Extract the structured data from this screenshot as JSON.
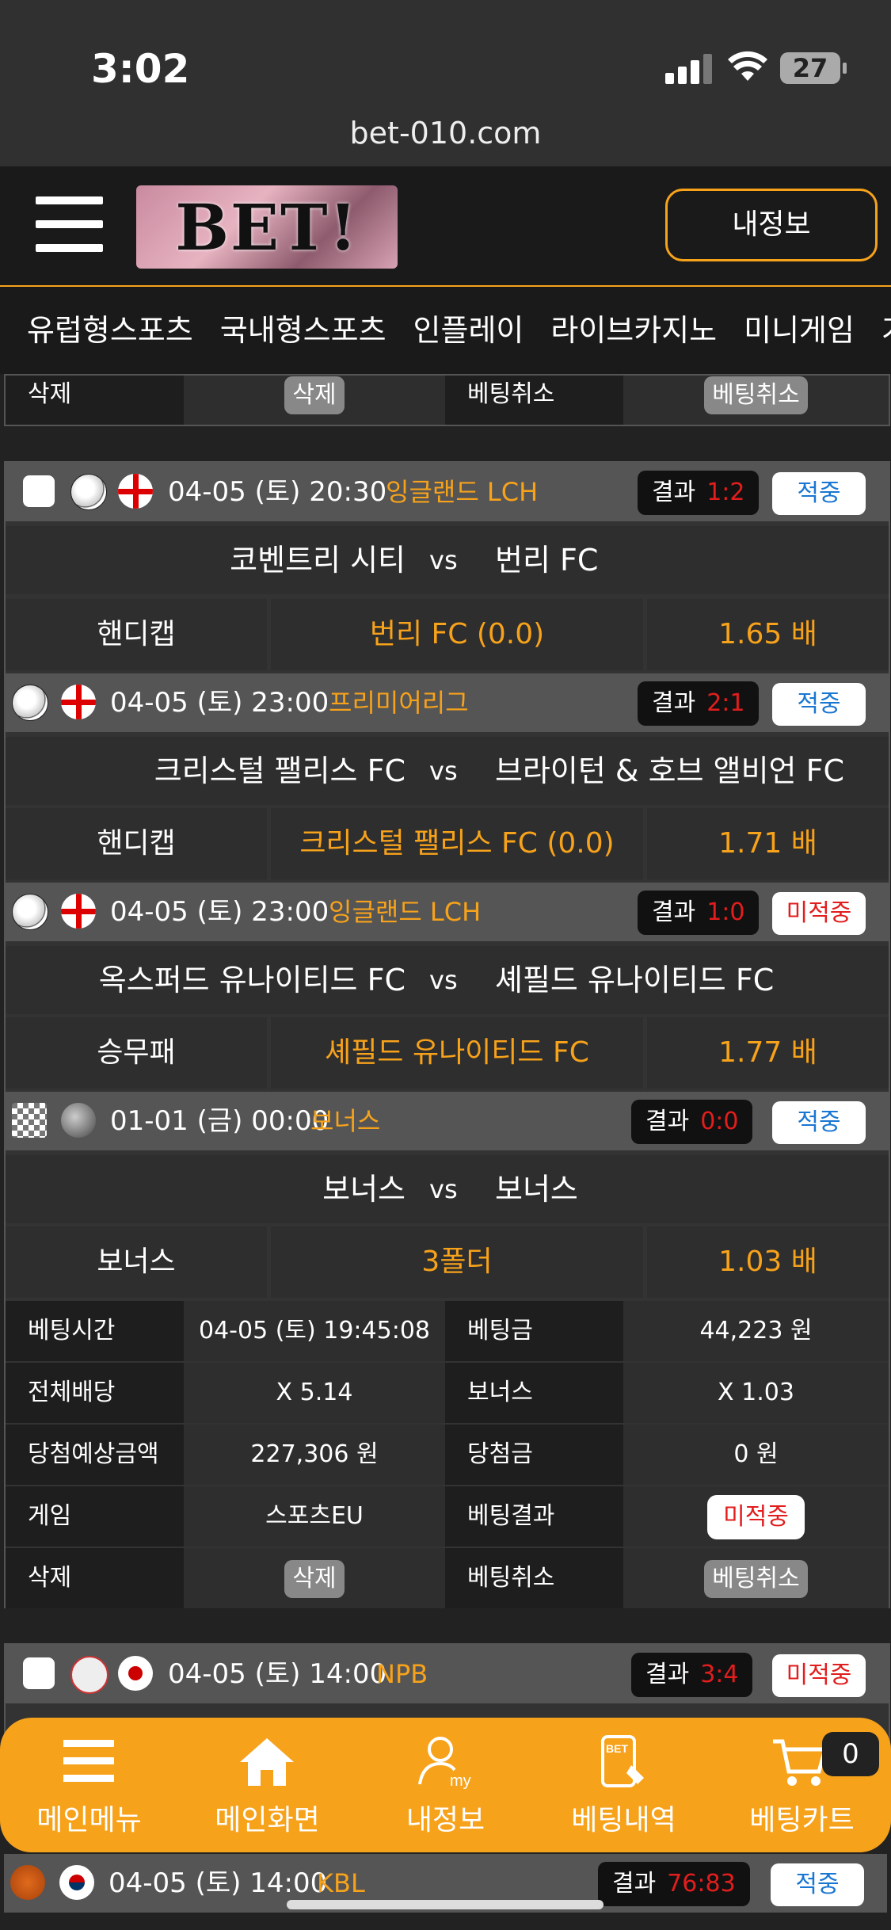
{
  "status_bar": {
    "time": "3:02",
    "battery": "27",
    "url": "bet-010.com"
  },
  "header": {
    "logo_text": "BET!",
    "my_info_button": "내정보"
  },
  "nav_tabs": [
    "유럽형스포츠",
    "국내형스포츠",
    "인플레이",
    "라이브카지노",
    "미니게임",
    "가"
  ],
  "top_partial_row": {
    "delete_label": "삭제",
    "delete_button": "삭제",
    "cancel_label": "베팅취소",
    "cancel_button": "베팅취소"
  },
  "slip": {
    "matches": [
      {
        "date": "04-05 (토) 20:30",
        "league": "잉글랜드 LCH",
        "result_label": "결과",
        "score": "1:2",
        "status": "적중",
        "home": "코벤트리 시티",
        "vs": "vs",
        "away": "번리 FC",
        "market": "핸디캡",
        "pick": "번리 FC  (0.0)",
        "odds": "1.65 배"
      },
      {
        "date": "04-05 (토) 23:00",
        "league": "프리미어리그",
        "result_label": "결과",
        "score": "2:1",
        "status": "적중",
        "home": "크리스털 팰리스 FC",
        "vs": "vs",
        "away": "브라이턴 & 호브 앨비언 FC",
        "market": "핸디캡",
        "pick": "크리스털 팰리스 FC  (0.0)",
        "odds": "1.71 배"
      },
      {
        "date": "04-05 (토) 23:00",
        "league": "잉글랜드 LCH",
        "result_label": "결과",
        "score": "1:0",
        "status": "미적중",
        "home": "옥스퍼드 유나이티드 FC",
        "vs": "vs",
        "away": "셰필드 유나이티드 FC",
        "market": "승무패",
        "pick": "셰필드 유나이티드 FC",
        "odds": "1.77 배"
      },
      {
        "date": "01-01 (금) 00:00",
        "league": "보너스",
        "result_label": "결과",
        "score": "0:0",
        "status": "적중",
        "home": "보너스",
        "vs": "vs",
        "away": "보너스",
        "market": "보너스",
        "pick": "3폴더",
        "odds": "1.03 배"
      }
    ],
    "info": {
      "bet_time_label": "베팅시간",
      "bet_time": "04-05 (토) 19:45:08",
      "stake_label": "베팅금",
      "stake": "44,223 원",
      "total_odds_label": "전체배당",
      "total_odds": "X 5.14",
      "bonus_label": "보너스",
      "bonus": "X 1.03",
      "expected_label": "당첨예상금액",
      "expected": "227,306 원",
      "win_label": "당첨금",
      "win": "0 원",
      "game_label": "게임",
      "game": "스포츠EU",
      "result_label": "베팅결과",
      "result": "미적중",
      "delete_label": "삭제",
      "delete_button": "삭제",
      "cancel_label": "베팅취소",
      "cancel_button": "베팅취소"
    }
  },
  "next_slip": {
    "date": "04-05 (토) 14:00",
    "league": "NPB",
    "result_label": "결과",
    "score": "3:4",
    "status": "미적중"
  },
  "last_row": {
    "date": "04-05 (토) 14:00",
    "league": "KBL",
    "result_label": "결과",
    "score": "76:83",
    "status": "적중"
  },
  "bottom_nav": {
    "menu": "메인메뉴",
    "home": "메인화면",
    "my": "내정보",
    "history": "베팅내역",
    "cart": "베팅카트",
    "cart_count": "0",
    "my_icon_text": "my",
    "bet_icon_text": "BET"
  },
  "colors": {
    "accent": "#f7a21b",
    "loss": "#e21d1d",
    "hit": "#1976d2"
  }
}
